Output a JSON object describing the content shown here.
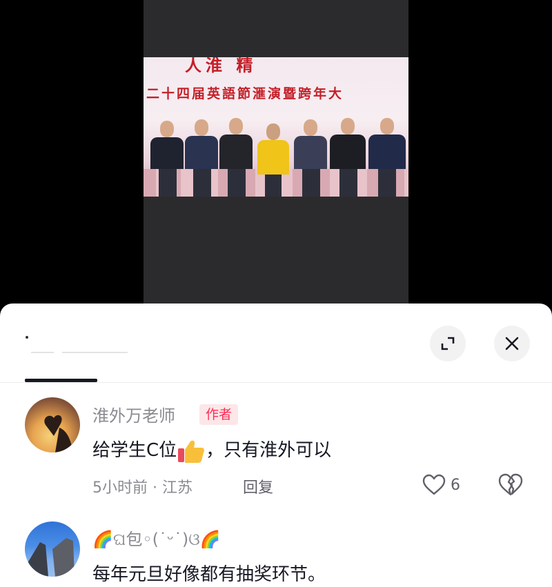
{
  "video": {
    "banner_top": "人淮    精",
    "banner_text": "二十四届英語節滙演暨跨年大"
  },
  "sheet": {
    "title": "",
    "expand_icon": "expand-icon",
    "close_icon": "close-icon",
    "comments": [
      {
        "username": "淮外万老师",
        "badge": "作者",
        "text_before": "给学生C位",
        "emoji": "thumbs-up",
        "text_after": "，只有淮外可以",
        "time_location": "5小时前 · 江苏",
        "reply_label": "回复",
        "like_count": "6"
      },
      {
        "username": "🌈ଘ包◦(˙ᵕ˙)ଓ🌈",
        "text": "每年元旦好像都有抽奖环节。"
      }
    ]
  },
  "colors": {
    "accent": "#fe2c55",
    "text_primary": "#161823",
    "text_secondary": "#8a8b91"
  }
}
